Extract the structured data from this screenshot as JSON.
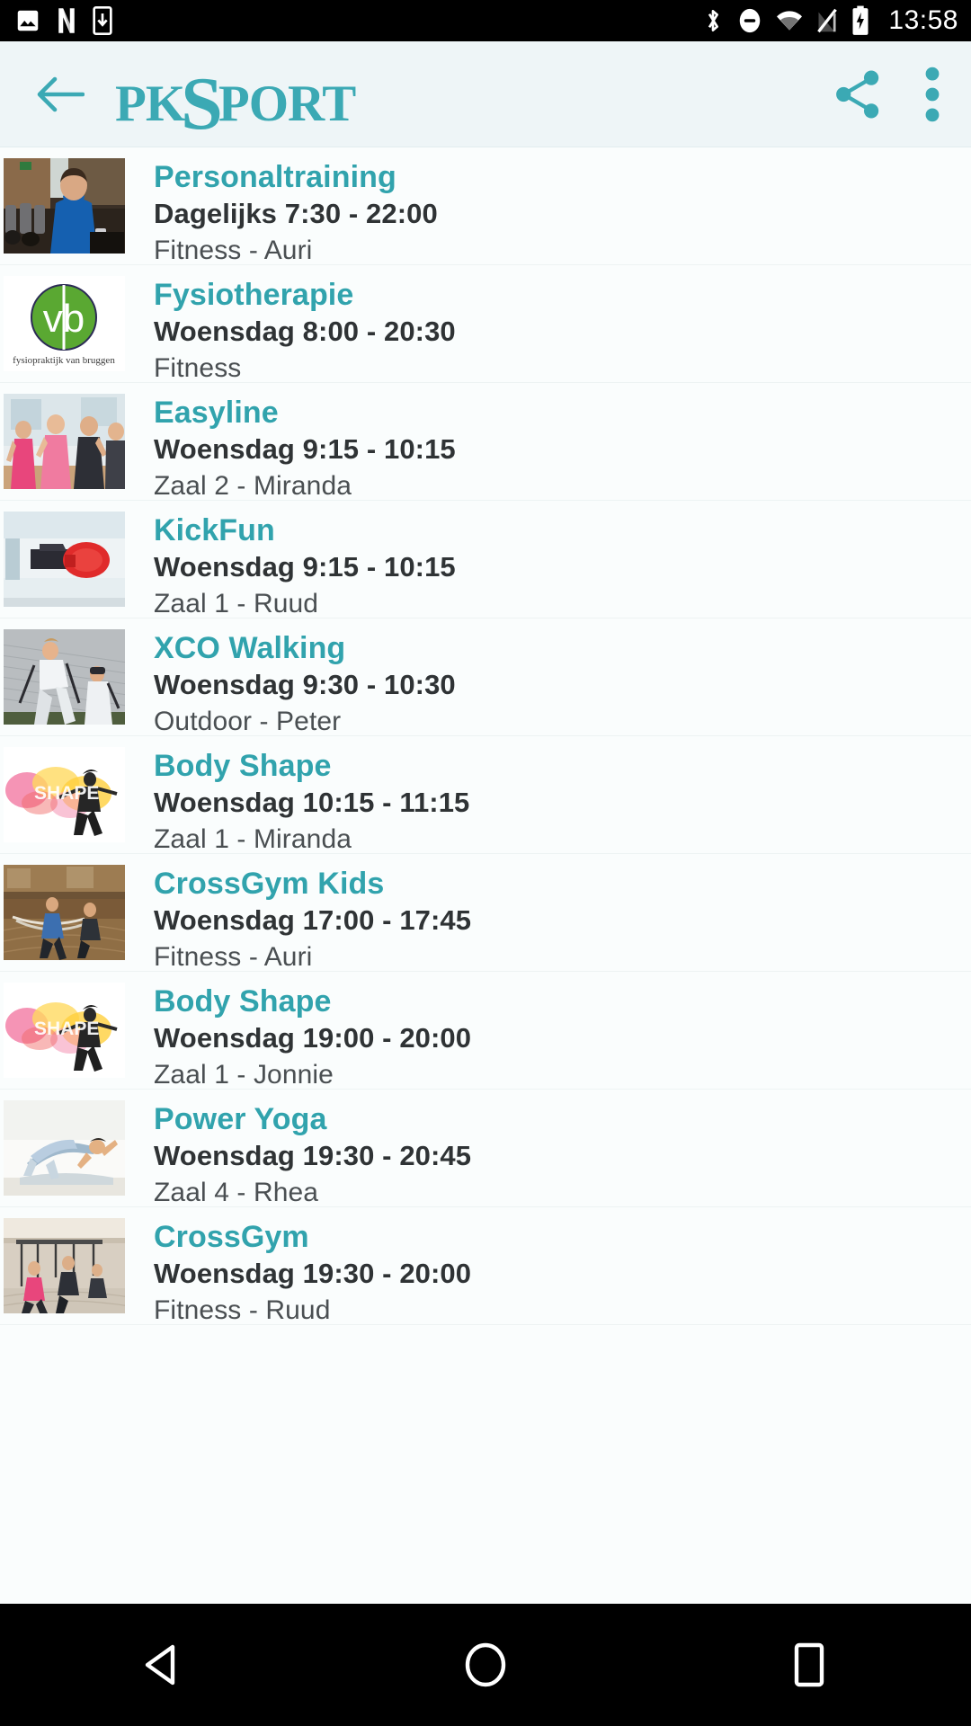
{
  "status_bar": {
    "time": "13:58",
    "left_icons": [
      "gallery-icon",
      "netflix-n-icon",
      "download-icon"
    ],
    "right_icons": [
      "bluetooth-icon",
      "do-not-disturb-icon",
      "wifi-icon",
      "signal-off-icon",
      "battery-charging-icon"
    ]
  },
  "app_bar": {
    "back_label": "back-arrow",
    "brand_pre": "PK",
    "brand_s": "S",
    "brand_post": "PORT",
    "share_label": "share",
    "overflow_label": "more options",
    "background": "#eef5f7",
    "accent": "#3ba9b4"
  },
  "theme": {
    "accent": "#31a3ad",
    "title_color": "#31a3ad",
    "time_color": "#2f3335",
    "location_color": "#4a4f52",
    "list_background": "#fafdfd",
    "divider": "#edf3f3"
  },
  "list": {
    "items": [
      {
        "title": "Personaltraining",
        "time": "Dagelijks 7:30 - 22:00",
        "location": "Fitness - Auri",
        "thumb": "gym-trainer-blue-shirt"
      },
      {
        "title": "Fysiotherapie",
        "time": "Woensdag 8:00 - 20:30",
        "location": "Fitness",
        "thumb": "vb-fysiopraktijk-van-bruggen-logo"
      },
      {
        "title": "Easyline",
        "time": "Woensdag 9:15 - 10:15",
        "location": "Zaal 2 - Miranda",
        "thumb": "group-fitness-women"
      },
      {
        "title": "KickFun",
        "time": "Woensdag 9:15 - 10:15",
        "location": "Zaal 1 - Ruud",
        "thumb": "boxing-glove-pad"
      },
      {
        "title": "XCO Walking",
        "time": "Woensdag 9:30 - 10:30",
        "location": "Outdoor - Peter",
        "thumb": "nordic-walking-stairs"
      },
      {
        "title": "Body Shape",
        "time": "Woensdag 10:15 - 11:15",
        "location": "Zaal 1 - Miranda",
        "thumb": "body-shape-splash-logo"
      },
      {
        "title": "CrossGym Kids",
        "time": "Woensdag 17:00 - 17:45",
        "location": "Fitness - Auri",
        "thumb": "crossgym-rope-training"
      },
      {
        "title": "Body Shape",
        "time": "Woensdag 19:00 - 20:00",
        "location": "Zaal 1 - Jonnie",
        "thumb": "body-shape-splash-logo"
      },
      {
        "title": "Power Yoga",
        "time": "Woensdag 19:30 - 20:45",
        "location": "Zaal 4 - Rhea",
        "thumb": "yoga-plank-pose"
      },
      {
        "title": "CrossGym",
        "time": "Woensdag 19:30 - 20:00",
        "location": "Fitness - Ruud",
        "thumb": "crossgym-suspension-training"
      }
    ]
  },
  "nav_bar": {
    "back": "back-triangle",
    "home": "home-circle",
    "recents": "recents-square"
  }
}
